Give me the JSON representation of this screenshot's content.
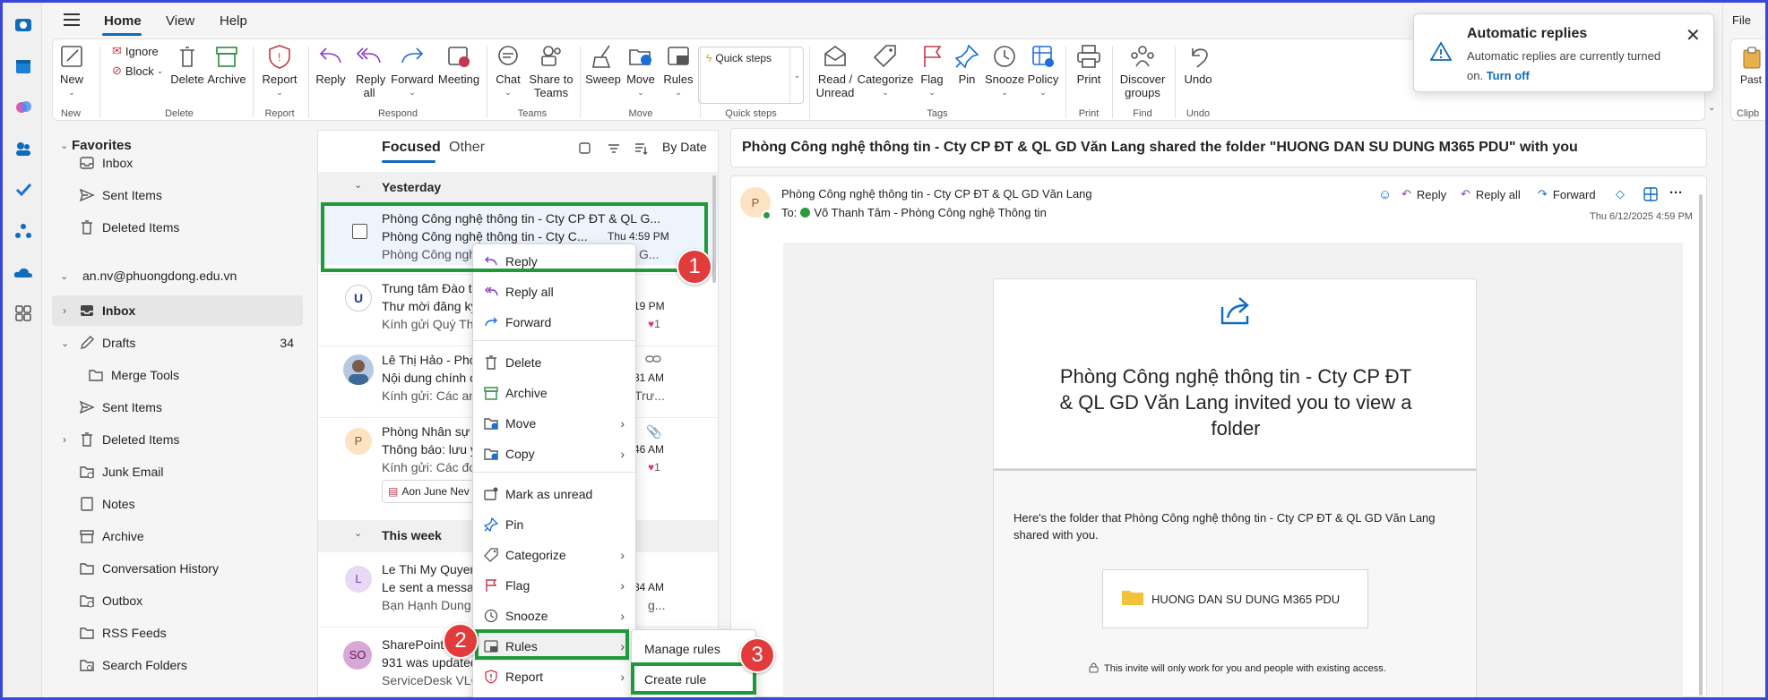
{
  "tabs": {
    "home": "Home",
    "view": "View",
    "help": "Help",
    "file": "File"
  },
  "ribbon": {
    "new": "New",
    "ignore": "Ignore",
    "block": "Block",
    "delete": "Delete",
    "archive": "Archive",
    "report": "Report",
    "reply": "Reply",
    "reply_all": "Reply all",
    "forward": "Forward",
    "meeting": "Meeting",
    "chat": "Chat",
    "share_to_teams": "Share to Teams",
    "sweep": "Sweep",
    "move": "Move",
    "rules": "Rules",
    "quick_steps": "Quick steps",
    "read_unread": "Read / Unread",
    "categorize": "Categorize",
    "flag": "Flag",
    "pin": "Pin",
    "snooze": "Snooze",
    "policy": "Policy",
    "print": "Print",
    "discover_groups": "Discover groups",
    "undo": "Undo",
    "paste": "Past",
    "groups": {
      "new": "New",
      "delete": "Delete",
      "report": "Report",
      "respond": "Respond",
      "teams": "Teams",
      "move": "Move",
      "quick_steps": "Quick steps",
      "tags": "Tags",
      "print": "Print",
      "find": "Find",
      "undo": "Undo",
      "clipboard": "Clipb"
    }
  },
  "toast": {
    "title": "Automatic replies",
    "body": "Automatic replies are currently turned on.",
    "action": "Turn off"
  },
  "nav": {
    "favorites": "Favorites",
    "fav_items": [
      "Inbox",
      "Sent Items",
      "Deleted Items"
    ],
    "account": "an.nv@phuongdong.edu.vn",
    "inbox": "Inbox",
    "drafts": "Drafts",
    "drafts_count": "34",
    "merge_tools": "Merge Tools",
    "sent": "Sent Items",
    "deleted": "Deleted Items",
    "junk": "Junk Email",
    "notes": "Notes",
    "archive": "Archive",
    "conv_history": "Conversation History",
    "outbox": "Outbox",
    "rss": "RSS Feeds",
    "search_folders": "Search Folders"
  },
  "list": {
    "focused": "Focused",
    "other": "Other",
    "sort": "By Date",
    "yesterday": "Yesterday",
    "this_week": "This week",
    "messages": [
      {
        "from": "Phòng Công nghệ thông tin - Cty CP ĐT & QL G...",
        "subject": "Phòng Công nghệ thông tin - Cty C...",
        "time": "Thu 4:59 PM",
        "preview": "Phòng Công ngh",
        "preview2": "G..."
      },
      {
        "from": "Trung tâm Đào tạ",
        "subject": "Thư mời đăng ký",
        "time": "19 PM",
        "preview": "Kính gửi Quý Thầ",
        "flag": "1"
      },
      {
        "from": "Lê Thị Hảo - Phò",
        "subject": "Nội dung chính c",
        "time": "31 AM",
        "preview": "Kính gửi: Các anl",
        "preview2": "Trư..."
      },
      {
        "from": "Phòng Nhân sự",
        "subject": "Thông báo: lưu y",
        "time": "46 AM",
        "preview": "Kính gửi: Các đơ",
        "flag": "1",
        "attachment": "Aon June Nev",
        "avatar": "P"
      },
      {
        "from": "Le Thi My Quyen",
        "subject": "Le sent a messag",
        "time": "34 AM",
        "preview": "Bạn Hạnh Dung",
        "preview2": "g...",
        "avatar": "L"
      },
      {
        "from": "SharePoint",
        "subject": "931 was updated",
        "preview": "ServiceDesk VLG",
        "avatar": "SO"
      }
    ]
  },
  "context_menu": {
    "items": [
      "Reply",
      "Reply all",
      "Forward",
      "Delete",
      "Archive",
      "Move",
      "Copy",
      "Mark as unread",
      "Pin",
      "Categorize",
      "Flag",
      "Snooze",
      "Rules",
      "Report"
    ]
  },
  "rules_submenu": {
    "manage": "Manage rules",
    "create": "Create rule"
  },
  "badges": [
    "1",
    "2",
    "3"
  ],
  "reading": {
    "subject": "Phòng Công nghệ thông tin - Cty CP ĐT & QL GD Văn Lang shared the folder \"HUONG DAN SU DUNG M365 PDU\" with you",
    "sender": "Phòng Công nghệ thông tin - Cty CP ĐT & QL GD Văn Lang",
    "to_label": "To:",
    "to": "Võ Thanh Tâm - Phòng Công nghệ Thông tin",
    "date": "Thu 6/12/2025 4:59 PM",
    "reply": "Reply",
    "reply_all": "Reply all",
    "forward": "Forward",
    "avatar": "P",
    "card_title": "Phòng Công nghệ thông tin - Cty CP ĐT & QL GD Văn Lang invited you to view a folder",
    "card_body": "Here's the folder that Phòng Công nghệ thông tin - Cty CP ĐT & QL GD Văn Lang shared with you.",
    "folder_name": "HUONG DAN SU DUNG M365 PDU",
    "invite_note": "This invite will only work for you and people with existing access."
  },
  "colors": {
    "highlight": "#1f9a3a",
    "badge": "#e23b3b",
    "accent": "#0f6cbd",
    "frame": "#3a48d8"
  }
}
